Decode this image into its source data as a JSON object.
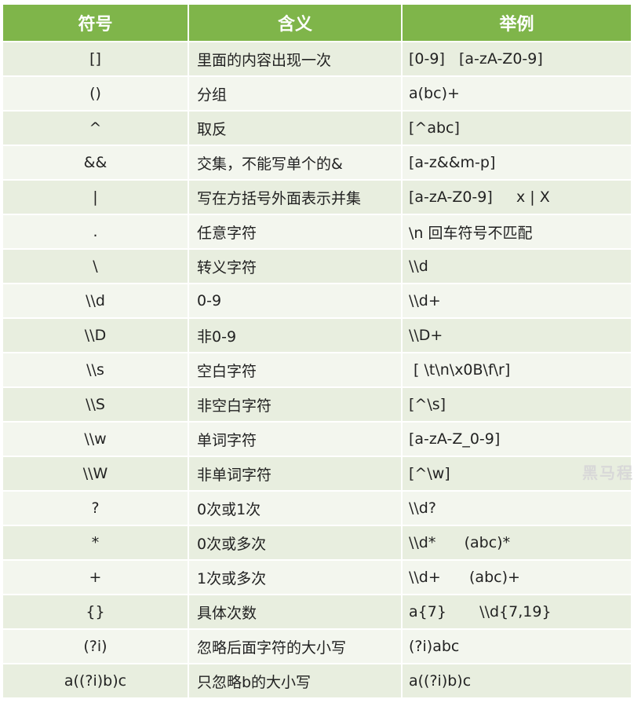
{
  "table": {
    "headers": [
      "符号",
      "含义",
      "举例"
    ],
    "rows": [
      {
        "symbol": "[]",
        "meaning": "里面的内容出现一次",
        "example": "[0-9]   [a-zA-Z0-9]"
      },
      {
        "symbol": "()",
        "meaning": "分组",
        "example": "a(bc)+"
      },
      {
        "symbol": "^",
        "meaning": "取反",
        "example": "[^abc]"
      },
      {
        "symbol": "&&",
        "meaning": "交集，不能写单个的&",
        "example": "[a-z&&m-p]"
      },
      {
        "symbol": "|",
        "meaning": "写在方括号外面表示并集",
        "example": "[a-zA-Z0-9]     x | X"
      },
      {
        "symbol": ".",
        "meaning": "任意字符",
        "example": "\\n 回车符号不匹配"
      },
      {
        "symbol": "\\",
        "meaning": "转义字符",
        "example": "\\\\d"
      },
      {
        "symbol": "\\\\d",
        "meaning": "0-9",
        "example": "\\\\d+"
      },
      {
        "symbol": "\\\\D",
        "meaning": "非0-9",
        "example": "\\\\D+"
      },
      {
        "symbol": "\\\\s",
        "meaning": "空白字符",
        "example": " [ \\t\\n\\x0B\\f\\r]"
      },
      {
        "symbol": "\\\\S",
        "meaning": "非空白字符",
        "example": "[^\\s]"
      },
      {
        "symbol": "\\\\w",
        "meaning": "单词字符",
        "example": "[a-zA-Z_0-9]"
      },
      {
        "symbol": "\\\\W",
        "meaning": "非单词字符",
        "example": "[^\\w]"
      },
      {
        "symbol": "?",
        "meaning": "0次或1次",
        "example": "\\\\d?"
      },
      {
        "symbol": "*",
        "meaning": "0次或多次",
        "example": "\\\\d*      (abc)*"
      },
      {
        "symbol": "+",
        "meaning": "1次或多次",
        "example": "\\\\d+      (abc)+"
      },
      {
        "symbol": "{}",
        "meaning": "具体次数",
        "example": "a{7}       \\\\d{7,19}"
      },
      {
        "symbol": "(?i)",
        "meaning": "忽略后面字符的大小写",
        "example": "(?i)abc"
      },
      {
        "symbol": "a((?i)b)c",
        "meaning": "只忽略b的大小写",
        "example": "a((?i)b)c"
      }
    ]
  },
  "watermark": "黑马程",
  "colors": {
    "header_bg": "#7fb54a",
    "row_odd": "#e8eedf",
    "row_even": "#f3f6ee",
    "text": "#222222"
  }
}
